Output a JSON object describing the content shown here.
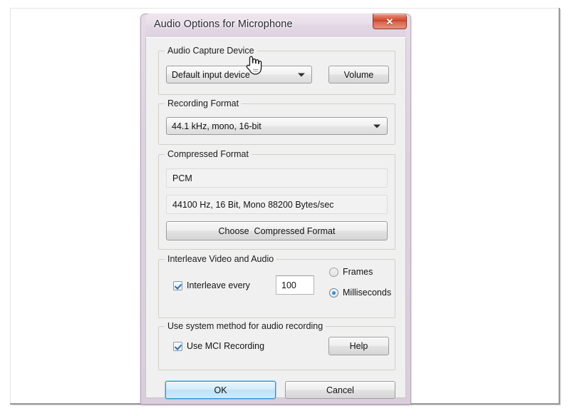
{
  "window": {
    "title": "Audio Options for Microphone",
    "close_label": "✕",
    "close_icon": "close-icon",
    "titlebar_color": "#e5dce6",
    "frame_color": "#d9cedb"
  },
  "groups": {
    "capture_device": {
      "title": "Audio Capture Device",
      "device_combo_value": "Default input device",
      "combo_arrow_icon": "chevron-down-icon",
      "volume_button": "Volume"
    },
    "recording_format": {
      "title": "Recording Format",
      "format_combo_value": "44.1 kHz, mono, 16-bit",
      "combo_arrow_icon": "chevron-down-icon"
    },
    "compressed_format": {
      "title": "Compressed Format",
      "codec_value": "PCM",
      "details_value": "44100 Hz, 16 Bit, Mono 88200 Bytes/sec",
      "choose_button": "Choose  Compressed Format"
    },
    "interleave": {
      "title": "Interleave Video and Audio",
      "checkbox_label": "Interleave every",
      "checkbox_checked": true,
      "interval_value": "100",
      "radio_frames_label": "Frames",
      "radio_frames_selected": false,
      "radio_milliseconds_label": "Milliseconds",
      "radio_milliseconds_selected": true
    },
    "system_method": {
      "title": "Use system method for audio recording",
      "checkbox_label": "Use MCI Recording",
      "checkbox_checked": true,
      "help_button": "Help"
    }
  },
  "footer": {
    "ok_button": "OK",
    "cancel_button": "Cancel"
  },
  "cursor": {
    "icon": "pointing-hand-cursor"
  }
}
